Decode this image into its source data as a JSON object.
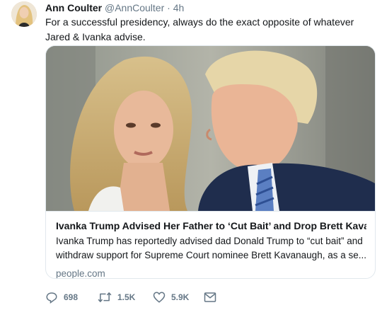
{
  "tweet": {
    "author_name": "Ann Coulter",
    "author_handle": "@AnnCoulter",
    "separator": "·",
    "time": "4h",
    "text": "For a successful presidency, always do the exact opposite of whatever Jared & Ivanka advise."
  },
  "card": {
    "title": "Ivanka Trump Advised Her Father to ‘Cut Bait’ and Drop Brett Kavanau...",
    "description": "Ivanka Trump has reportedly advised dad Donald Trump to “cut bait” and withdraw support for Supreme Court nominee Brett Kavanaugh, as a se...",
    "domain": "people.com"
  },
  "actions": {
    "replies": "698",
    "retweets": "1.5K",
    "likes": "5.9K"
  },
  "icons": {
    "reply": "reply-icon",
    "retweet": "retweet-icon",
    "like": "heart-icon",
    "message": "envelope-icon"
  },
  "colors": {
    "text": "#14171a",
    "secondary": "#657786",
    "border": "#e1e8ed"
  }
}
